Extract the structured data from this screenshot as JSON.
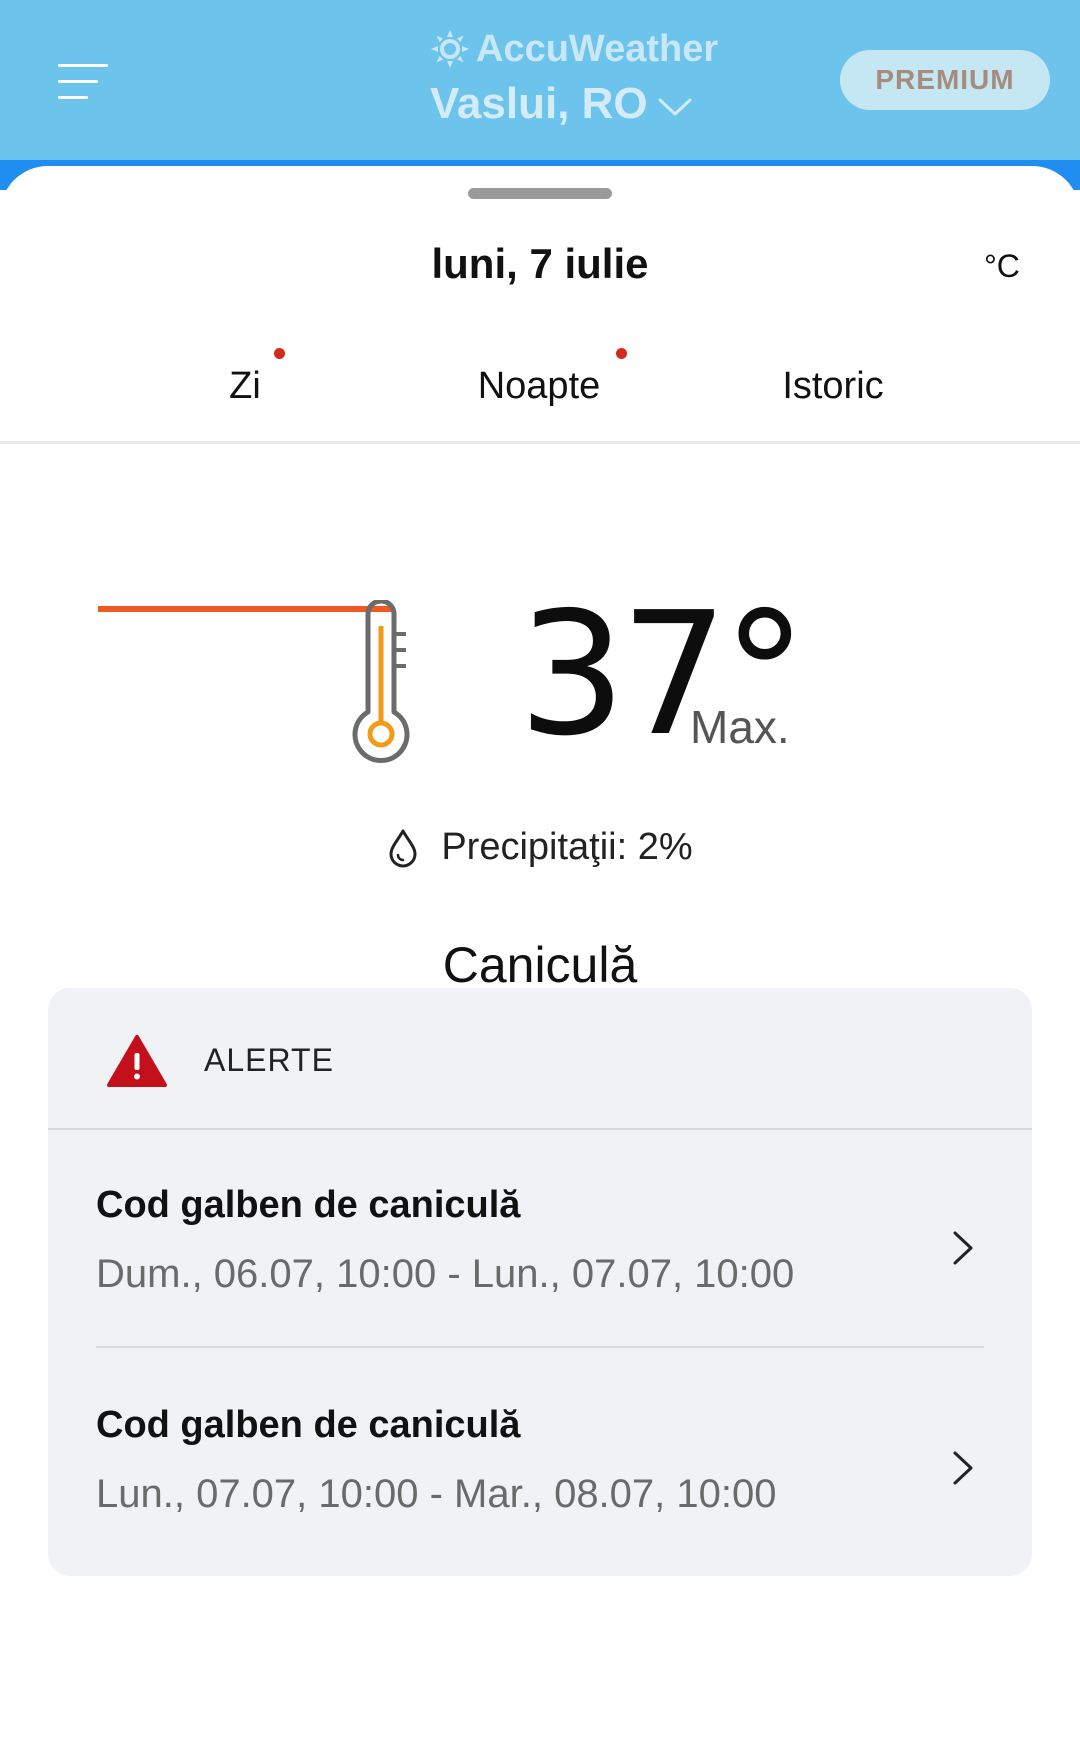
{
  "header": {
    "brand": "AccuWeather",
    "location": "Vaslui, RO",
    "premium_label": "PREMIUM",
    "menu_icon": "hamburger-menu-icon",
    "colors": {
      "background": "#6cc3ec",
      "accent_edge": "#1f8ef0"
    }
  },
  "sheet": {
    "date": "luni, 7 iulie",
    "unit": "°C",
    "tabs": [
      {
        "label": "Zi",
        "active": true,
        "has_dot": true
      },
      {
        "label": "Noapte",
        "active": false,
        "has_dot": true
      },
      {
        "label": "Istoric",
        "active": false,
        "has_dot": false
      }
    ],
    "accent_color": "#f05a22"
  },
  "forecast": {
    "temperature": "37°",
    "temperature_label": "Max.",
    "precipitation": "Precipitaţii: 2%",
    "condition": "Caniculă",
    "icons": {
      "temperature": "thermometer-icon",
      "precipitation": "drop-icon"
    }
  },
  "alerts": {
    "title": "ALERTE",
    "icon": "warning-triangle-icon",
    "items": [
      {
        "title": "Cod galben de caniculă",
        "period": "Dum., 06.07, 10:00 - Lun., 07.07, 10:00"
      },
      {
        "title": "Cod galben de caniculă",
        "period": "Lun., 07.07, 10:00 - Mar., 08.07, 10:00"
      }
    ]
  }
}
